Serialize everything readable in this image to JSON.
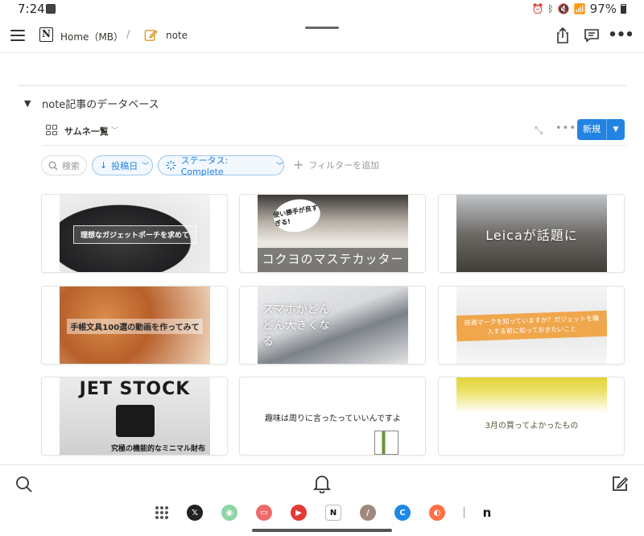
{
  "status": {
    "time": "7:24",
    "battery": "97%"
  },
  "nav": {
    "home_label": "Home（MB）",
    "separator": "/",
    "page_label": "note"
  },
  "database": {
    "toggle": "▼",
    "title": "note記事のデータベース",
    "view_label": "サムネ一覧",
    "new_button": "新規"
  },
  "filters": {
    "search": "検索",
    "date": "投稿日",
    "status": "ステータス: Complete",
    "add": "フィルターを追加"
  },
  "gallery": [
    {
      "caption": "理想なガジェットポーチを求めて"
    },
    {
      "caption": "コクヨのマステカッター",
      "bubble": "使い勝手が良すぎる!"
    },
    {
      "caption": "Leicaが話題に"
    },
    {
      "caption": "手帳文具100選の動画を作ってみて"
    },
    {
      "caption": "スマホがどんどん大きくなる"
    },
    {
      "caption": "技適マークを知っていますか？ガジェットを購入する前に知っておきたいこと"
    },
    {
      "title": "JET STOCK",
      "caption": "究極の機能的なミニマル財布"
    },
    {
      "caption": "趣味は周りに言ったっていいんですよ"
    },
    {
      "caption": "3月の買ってよかったもの"
    }
  ],
  "colors": {
    "accent": "#2383e2",
    "text": "#37352f",
    "muted": "#9b9a97"
  }
}
